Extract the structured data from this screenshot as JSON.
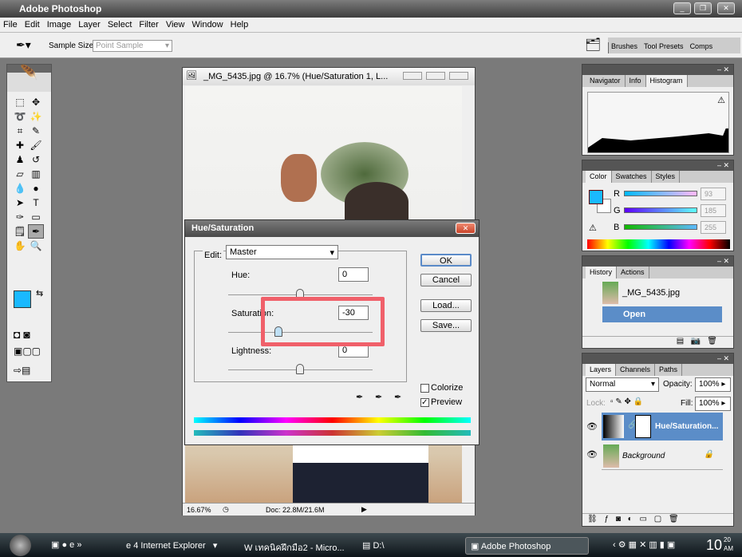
{
  "app": {
    "title": "Adobe Photoshop"
  },
  "menu": [
    "File",
    "Edit",
    "Image",
    "Layer",
    "Select",
    "Filter",
    "View",
    "Window",
    "Help"
  ],
  "options": {
    "sample_size_label": "Sample Size:",
    "sample_size_value": "Point Sample"
  },
  "well_tabs": [
    "Brushes",
    "Tool Presets",
    "Comps"
  ],
  "document": {
    "title": "_MG_5435.jpg @ 16.7% (Hue/Saturation 1, L...",
    "zoom": "16.67%",
    "doc_size": "Doc: 22.8M/21.6M"
  },
  "dialog": {
    "title": "Hue/Saturation",
    "edit_label": "Edit:",
    "edit_value": "Master",
    "hue_label": "Hue:",
    "hue_value": "0",
    "saturation_label": "Saturation:",
    "saturation_value": "-30",
    "lightness_label": "Lightness:",
    "lightness_value": "0",
    "ok": "OK",
    "cancel": "Cancel",
    "load": "Load...",
    "save": "Save...",
    "colorize_label": "Colorize",
    "colorize_checked": false,
    "preview_label": "Preview",
    "preview_checked": true,
    "highlight_color": "#f0606a"
  },
  "histogram_panel": {
    "tabs": [
      "Navigator",
      "Info",
      "Histogram"
    ],
    "active": "Histogram"
  },
  "color_panel": {
    "tabs": [
      "Color",
      "Swatches",
      "Styles"
    ],
    "r_label": "R",
    "g_label": "G",
    "b_label": "B",
    "r": "93",
    "g": "185",
    "b": "255",
    "foreground": "#1ab9ff"
  },
  "history_panel": {
    "tabs": [
      "History",
      "Actions"
    ],
    "snapshot": "_MG_5435.jpg",
    "step": "Open"
  },
  "layers_panel": {
    "tabs": [
      "Layers",
      "Channels",
      "Paths"
    ],
    "blend_mode": "Normal",
    "opacity_label": "Opacity:",
    "opacity": "100%",
    "lock_label": "Lock:",
    "fill_label": "Fill:",
    "fill": "100%",
    "layers": [
      {
        "name": "Hue/Saturation...",
        "selected": true
      },
      {
        "name": "Background",
        "selected": false
      }
    ]
  },
  "taskbar": {
    "items": [
      "4 Internet Explorer",
      "เทคนิคฝึกมือ2 - Micro...",
      "D:\\",
      "Adobe Photoshop"
    ],
    "clock": "10",
    "clock_ampm": "AM",
    "clock_min": "20"
  }
}
